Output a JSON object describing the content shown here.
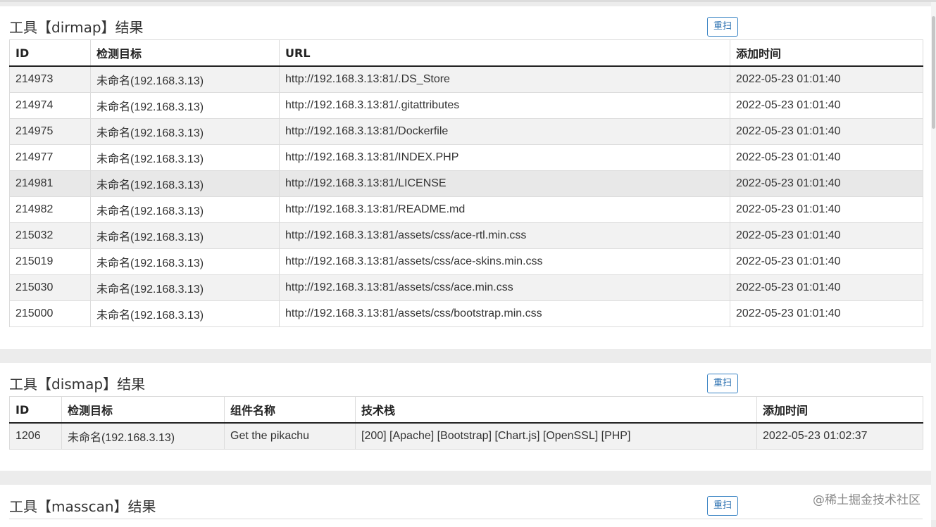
{
  "sections": [
    {
      "title": "工具【dirmap】结果",
      "rescan_label": "重扫",
      "columns": [
        "ID",
        "检测目标",
        "URL",
        "添加时间"
      ],
      "rows": [
        [
          "214973",
          "未命名(192.168.3.13)",
          "http://192.168.3.13:81/.DS_Store",
          "2022-05-23 01:01:40"
        ],
        [
          "214974",
          "未命名(192.168.3.13)",
          "http://192.168.3.13:81/.gitattributes",
          "2022-05-23 01:01:40"
        ],
        [
          "214975",
          "未命名(192.168.3.13)",
          "http://192.168.3.13:81/Dockerfile",
          "2022-05-23 01:01:40"
        ],
        [
          "214977",
          "未命名(192.168.3.13)",
          "http://192.168.3.13:81/INDEX.PHP",
          "2022-05-23 01:01:40"
        ],
        [
          "214981",
          "未命名(192.168.3.13)",
          "http://192.168.3.13:81/LICENSE",
          "2022-05-23 01:01:40"
        ],
        [
          "214982",
          "未命名(192.168.3.13)",
          "http://192.168.3.13:81/README.md",
          "2022-05-23 01:01:40"
        ],
        [
          "215032",
          "未命名(192.168.3.13)",
          "http://192.168.3.13:81/assets/css/ace-rtl.min.css",
          "2022-05-23 01:01:40"
        ],
        [
          "215019",
          "未命名(192.168.3.13)",
          "http://192.168.3.13:81/assets/css/ace-skins.min.css",
          "2022-05-23 01:01:40"
        ],
        [
          "215030",
          "未命名(192.168.3.13)",
          "http://192.168.3.13:81/assets/css/ace.min.css",
          "2022-05-23 01:01:40"
        ],
        [
          "215000",
          "未命名(192.168.3.13)",
          "http://192.168.3.13:81/assets/css/bootstrap.min.css",
          "2022-05-23 01:01:40"
        ]
      ]
    },
    {
      "title": "工具【dismap】结果",
      "rescan_label": "重扫",
      "columns": [
        "ID",
        "检测目标",
        "组件名称",
        "技术栈",
        "添加时间"
      ],
      "rows": [
        [
          "1206",
          "未命名(192.168.3.13)",
          "Get the pikachu",
          "[200] [Apache] [Bootstrap] [Chart.js] [OpenSSL] [PHP]",
          "2022-05-23 01:02:37"
        ]
      ]
    },
    {
      "title": "工具【masscan】结果",
      "rescan_label": "重扫",
      "columns": [],
      "rows": []
    }
  ],
  "watermark": "@稀土掘金技术社区"
}
